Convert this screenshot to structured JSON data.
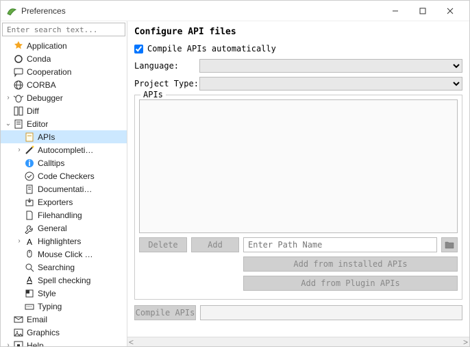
{
  "window": {
    "title": "Preferences"
  },
  "search": {
    "placeholder": "Enter search text..."
  },
  "tree": [
    {
      "label": "Application",
      "indent": 0,
      "expand": "",
      "icon": "star",
      "selected": false
    },
    {
      "label": "Conda",
      "indent": 0,
      "expand": "",
      "icon": "circle",
      "selected": false
    },
    {
      "label": "Cooperation",
      "indent": 0,
      "expand": "",
      "icon": "chat",
      "selected": false
    },
    {
      "label": "CORBA",
      "indent": 0,
      "expand": "",
      "icon": "globe",
      "selected": false
    },
    {
      "label": "Debugger",
      "indent": 0,
      "expand": ">",
      "icon": "bug",
      "selected": false
    },
    {
      "label": "Diff",
      "indent": 0,
      "expand": "",
      "icon": "diff",
      "selected": false
    },
    {
      "label": "Editor",
      "indent": 0,
      "expand": "v",
      "icon": "edit",
      "selected": false
    },
    {
      "label": "APIs",
      "indent": 1,
      "expand": "",
      "icon": "apis",
      "selected": true
    },
    {
      "label": "Autocompleti…",
      "indent": 1,
      "expand": ">",
      "icon": "wand",
      "selected": false
    },
    {
      "label": "Calltips",
      "indent": 1,
      "expand": "",
      "icon": "info",
      "selected": false
    },
    {
      "label": "Code Checkers",
      "indent": 1,
      "expand": "",
      "icon": "check",
      "selected": false
    },
    {
      "label": "Documentati…",
      "indent": 1,
      "expand": "",
      "icon": "doc",
      "selected": false
    },
    {
      "label": "Exporters",
      "indent": 1,
      "expand": "",
      "icon": "export",
      "selected": false
    },
    {
      "label": "Filehandling",
      "indent": 1,
      "expand": "",
      "icon": "file",
      "selected": false
    },
    {
      "label": "General",
      "indent": 1,
      "expand": "",
      "icon": "wrench",
      "selected": false
    },
    {
      "label": "Highlighters",
      "indent": 1,
      "expand": ">",
      "icon": "font",
      "selected": false
    },
    {
      "label": "Mouse Click …",
      "indent": 1,
      "expand": "",
      "icon": "mouse",
      "selected": false
    },
    {
      "label": "Searching",
      "indent": 1,
      "expand": "",
      "icon": "search",
      "selected": false
    },
    {
      "label": "Spell checking",
      "indent": 1,
      "expand": "",
      "icon": "spell",
      "selected": false
    },
    {
      "label": "Style",
      "indent": 1,
      "expand": "",
      "icon": "style",
      "selected": false
    },
    {
      "label": "Typing",
      "indent": 1,
      "expand": "",
      "icon": "keyboard",
      "selected": false
    },
    {
      "label": "Email",
      "indent": 0,
      "expand": "",
      "icon": "mail",
      "selected": false
    },
    {
      "label": "Graphics",
      "indent": 0,
      "expand": "",
      "icon": "image",
      "selected": false
    },
    {
      "label": "Help",
      "indent": 0,
      "expand": ">",
      "icon": "help",
      "selected": false
    }
  ],
  "panel": {
    "heading": "Configure API files",
    "compile_auto_label": "Compile APIs automatically",
    "compile_auto_checked": true,
    "language_label": "Language:",
    "project_type_label": "Project Type:",
    "apis_group_label": "APIs",
    "delete_label": "Delete",
    "add_label": "Add",
    "path_placeholder": "Enter Path Name",
    "add_installed_label": "Add from installed APIs",
    "add_plugin_label": "Add from Plugin APIs",
    "compile_btn_label": "Compile APIs"
  }
}
